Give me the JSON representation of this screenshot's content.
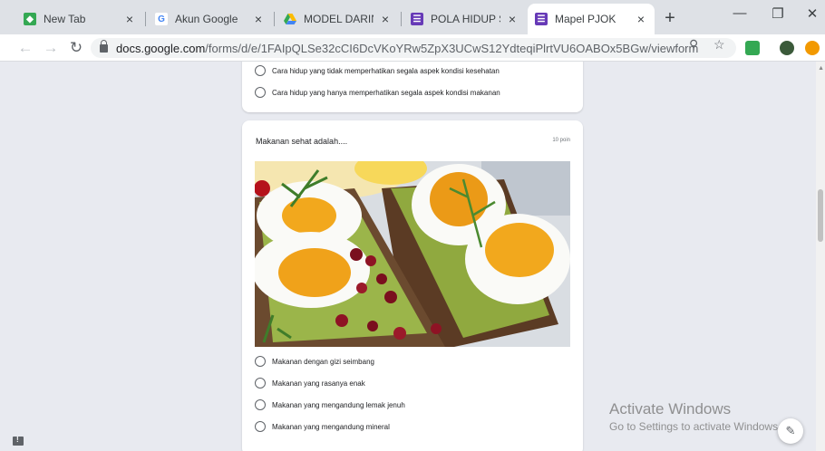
{
  "tabs": [
    {
      "title": "New Tab",
      "icon": "new-tab-icon",
      "color": "#34a853"
    },
    {
      "title": "Akun Google",
      "icon": "google-g-icon",
      "color": "#4285f4"
    },
    {
      "title": "MODEL DARING",
      "icon": "google-drive-icon",
      "color": "#fbbc04"
    },
    {
      "title": "POLA HIDUP SEH",
      "icon": "google-forms-icon",
      "color": "#673ab7"
    },
    {
      "title": "Mapel PJOK",
      "icon": "google-forms-icon",
      "color": "#673ab7"
    }
  ],
  "active_tab_index": 4,
  "toolbar": {
    "url_host": "docs.google.com",
    "url_path": "/forms/d/e/1FAIpQLSe32cCI6DcVKoYRw5ZpX3UCwS12YdteqiPlrtVU6OABOx5BGw/viewform"
  },
  "question1": {
    "options": [
      "Cara hidup yang tidak memperhatikan segala aspek kondisi kesehatan",
      "Cara hidup yang hanya memperhatikan segala aspek kondisi makanan"
    ]
  },
  "question2": {
    "title": "Makanan sehat adalah....",
    "points": "10 poin",
    "options": [
      "Makanan dengan gizi seimbang",
      "Makanan yang rasanya enak",
      "Makanan yang mengandung lemak jenuh",
      "Makanan yang mengandung mineral"
    ]
  },
  "watermark": {
    "line1": "Activate Windows",
    "line2": "Go to Settings to activate Windows."
  },
  "colors": {
    "page_bg": "#e8eaf0",
    "forms_purple": "#673ab7",
    "egg_yolk": "#f2a81d",
    "avocado": "#9bb54a",
    "toast": "#6b4a2f"
  }
}
